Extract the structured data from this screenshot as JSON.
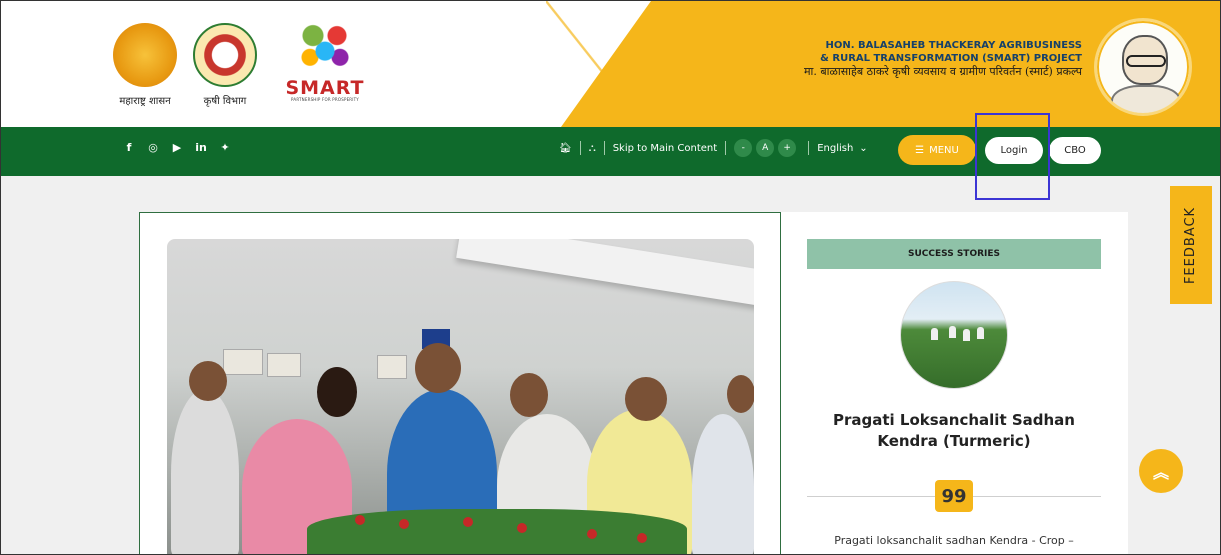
{
  "header": {
    "logos": [
      {
        "caption": "महाराष्ट्र शासन"
      },
      {
        "caption": "कृषी विभाग"
      },
      {
        "brand": "SMART",
        "tagline": "PARTNERSHIP FOR PROSPERITY"
      }
    ],
    "project_title_line1": "HON. BALASAHEB THACKERAY AGRIBUSINESS",
    "project_title_line2": "& RURAL TRANSFORMATION (SMART) PROJECT",
    "project_title_marathi": "मा. बाळासाहेब ठाकरे कृषी व्यवसाय व ग्रामीण परिवर्तन (स्मार्ट) प्रकल्प"
  },
  "navbar": {
    "social": [
      "f",
      "◎",
      "▶",
      "in",
      "✦"
    ],
    "skip_link": "Skip to Main Content",
    "font_decrease": "-",
    "font_normal": "A",
    "font_increase": "+",
    "language": "English",
    "menu_label": "MENU",
    "login_label": "Login",
    "cbo_label": "CBO"
  },
  "success_stories": {
    "heading": "SUCCESS STORIES",
    "title": "Pragati Loksanchalit Sadhan Kendra (Turmeric)",
    "quote_mark": "99",
    "excerpt": "Pragati loksanchalit sadhan Kendra - Crop –"
  },
  "feedback_label": "FEEDBACK",
  "colors": {
    "brand_green": "#0f6a2c",
    "brand_yellow": "#f5b61a",
    "highlight": "#3c35d4"
  }
}
